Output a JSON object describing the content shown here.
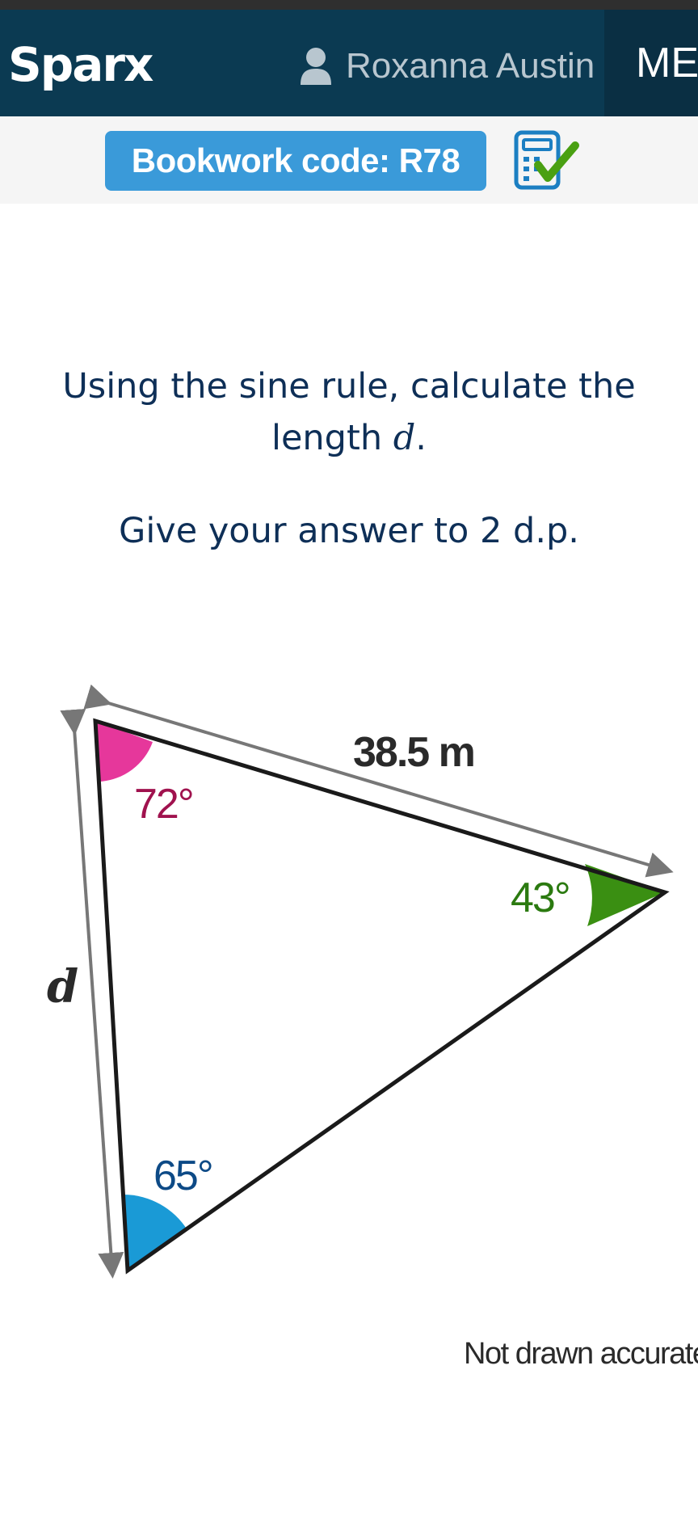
{
  "header": {
    "logo_text": "Sparx",
    "user_icon": "user-icon",
    "user_name": "Roxanna Austin",
    "menu_label": "ME"
  },
  "bookwork": {
    "label": "Bookwork code: R78",
    "calculator_icon": "calculator-check-icon"
  },
  "question": {
    "line1": "Using the sine rule, calculate the",
    "line2_prefix": "length ",
    "variable": "d",
    "line2_suffix": ".",
    "instruction": "Give your answer to 2 d.p."
  },
  "diagram": {
    "side_label": "38.5 m",
    "unknown_side_label": "d",
    "angle_top_left": "72°",
    "angle_right": "43°",
    "angle_bottom_left": "65°",
    "colors": {
      "angle_72": "#e6379b",
      "angle_43": "#3a8f12",
      "angle_65": "#1a9ad6",
      "label_72": "#a0124e",
      "label_43": "#2b7a10",
      "label_65": "#0d4a86",
      "arrow": "#777777"
    }
  },
  "footer_note": "Not drawn accurately",
  "theme": {
    "navbar_bg": "#0b3a52",
    "bookwork_bg": "#3a9ad9",
    "text_color": "#0e2f57"
  }
}
